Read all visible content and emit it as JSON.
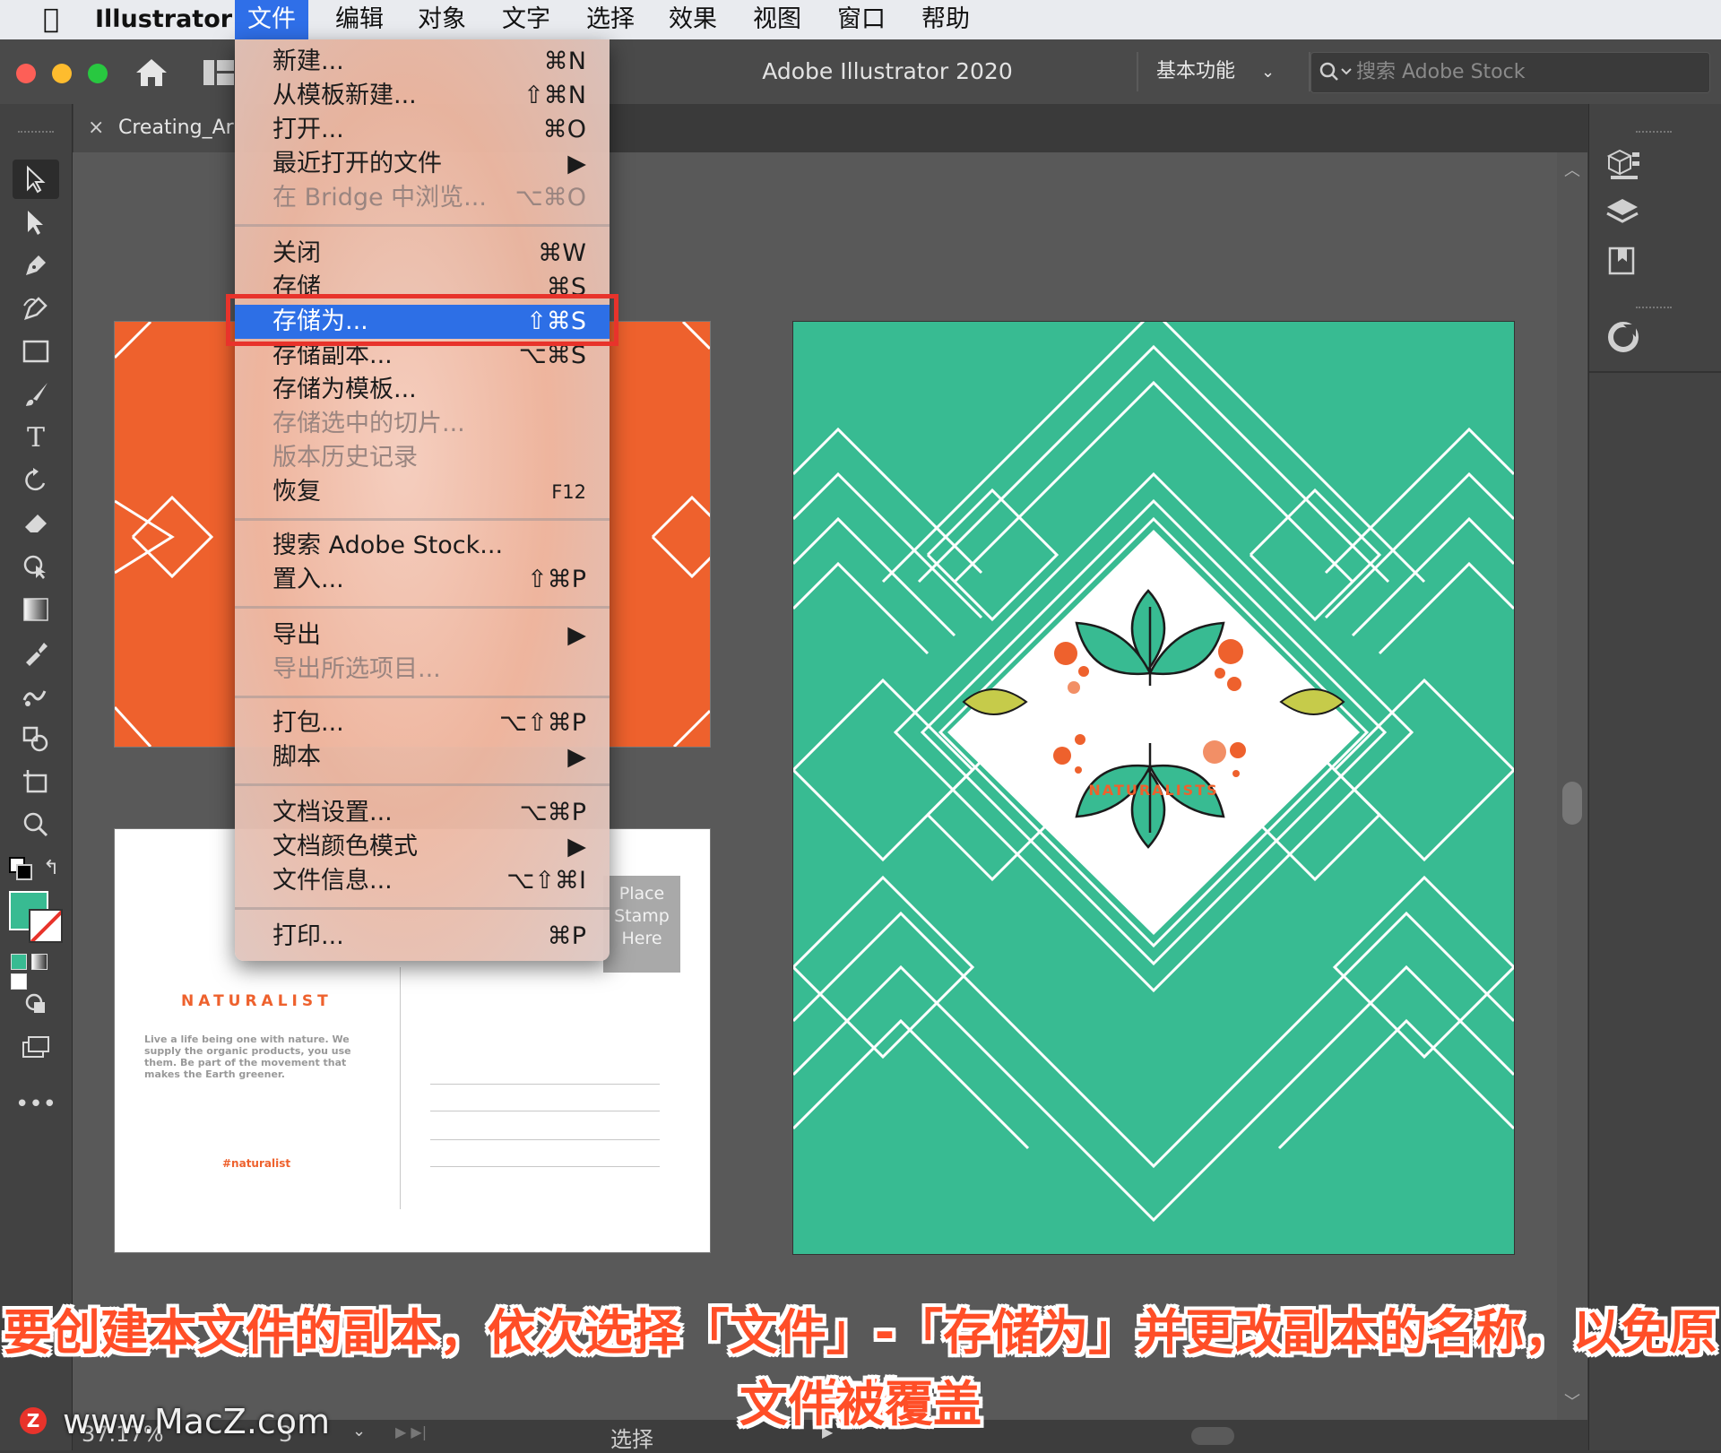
{
  "menubar": {
    "app_name": "Illustrator",
    "items": [
      "文件",
      "编辑",
      "对象",
      "文字",
      "选择",
      "效果",
      "视图",
      "窗口",
      "帮助"
    ]
  },
  "appbar": {
    "window_title": "Adobe Illustrator 2020",
    "workspace": "基本功能",
    "search_placeholder": "搜索 Adobe Stock"
  },
  "tab": {
    "close": "×",
    "doc_name": "Creating_Ar"
  },
  "file_menu": {
    "new": {
      "label": "新建...",
      "shortcut": "⌘N"
    },
    "new_from_template": {
      "label": "从模板新建...",
      "shortcut": "⇧⌘N"
    },
    "open": {
      "label": "打开...",
      "shortcut": "⌘O"
    },
    "open_recent": {
      "label": "最近打开的文件",
      "shortcut": "▶"
    },
    "browse_bridge": {
      "label": "在 Bridge 中浏览...",
      "shortcut": "⌥⌘O"
    },
    "close": {
      "label": "关闭",
      "shortcut": "⌘W"
    },
    "save": {
      "label": "存储",
      "shortcut": "⌘S"
    },
    "save_as": {
      "label": "存储为...",
      "shortcut": "⇧⌘S"
    },
    "save_copy": {
      "label": "存储副本...",
      "shortcut": "⌥⌘S"
    },
    "save_template": {
      "label": "存储为模板...",
      "shortcut": ""
    },
    "save_slices": {
      "label": "存储选中的切片...",
      "shortcut": ""
    },
    "version_history": {
      "label": "版本历史记录",
      "shortcut": ""
    },
    "revert": {
      "label": "恢复",
      "shortcut": "F12"
    },
    "search_stock": {
      "label": "搜索 Adobe Stock...",
      "shortcut": ""
    },
    "place": {
      "label": "置入...",
      "shortcut": "⇧⌘P"
    },
    "export": {
      "label": "导出",
      "shortcut": "▶"
    },
    "export_selection": {
      "label": "导出所选项目...",
      "shortcut": ""
    },
    "package": {
      "label": "打包...",
      "shortcut": "⌥⇧⌘P"
    },
    "scripts": {
      "label": "脚本",
      "shortcut": "▶"
    },
    "doc_setup": {
      "label": "文档设置...",
      "shortcut": "⌥⌘P"
    },
    "doc_color_mode": {
      "label": "文档颜色模式",
      "shortcut": "▶"
    },
    "file_info": {
      "label": "文件信息...",
      "shortcut": "⌥⇧⌘I"
    },
    "print": {
      "label": "打印...",
      "shortcut": "⌘P"
    }
  },
  "postcard": {
    "brand": "NATURALIST",
    "body": "Live a life being one with nature. We supply the organic products, you use them. Be part of the movement that makes the Earth greener.",
    "hashtag": "#naturalist",
    "stamp": [
      "Place",
      "Stamp",
      "Here"
    ]
  },
  "poster": {
    "brand": "NATURALISTS"
  },
  "statusbar": {
    "zoom": "37.17%",
    "artboard": "3",
    "mode": "选择"
  },
  "caption": {
    "line1": "要创建本文件的副本，依次选择「文件」-「存储为」并更改副本的名称，以免原有的",
    "line2": "文件被覆盖"
  },
  "watermark": "www.MacZ.com",
  "colors": {
    "accent": "#2f6fe8",
    "orange": "#ee612d",
    "teal": "#38bb92",
    "highlight": "#e8332b",
    "lime": "#c6cb4a"
  }
}
